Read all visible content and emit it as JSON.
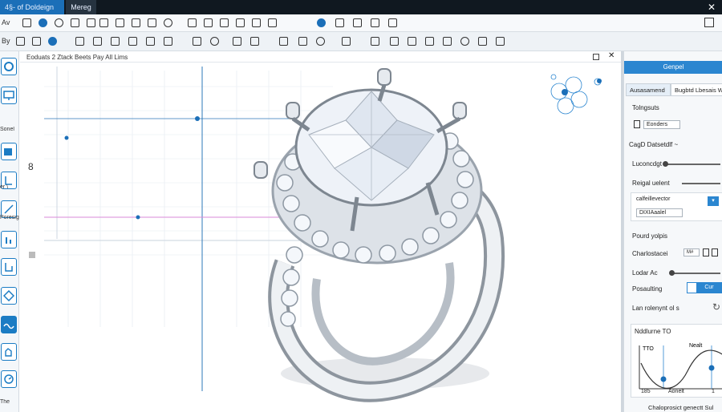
{
  "titlebar": {
    "tabs": [
      "4§- of Doldeign",
      "Mereg"
    ]
  },
  "toolbar1": {
    "label_left": "Av"
  },
  "toolbar2": {
    "label_left": "By"
  },
  "left_rail": {
    "labels": [
      "Sonel",
      "er  \\",
      "Poresign",
      "The"
    ]
  },
  "viewport": {
    "title": "Eoduats 2 Ztack Beets Pay All Lims",
    "dim_label": "8",
    "colors": {
      "grid": "#d9e1ea",
      "guide": "#1b6fb8",
      "pink_line": "#d98ad8"
    }
  },
  "right_panel": {
    "header": "Genpel",
    "tabs": [
      "Ausasamend",
      "Bugbtd Lbesais Wa"
    ],
    "toolgroup_label": "Tolngsuts",
    "toolgroup_button": "Eonders",
    "section_title": "CagD Datsetdlf ~",
    "rows": [
      "Luconcdgt",
      "Reigal uelent"
    ],
    "select_label": "calfeillevector",
    "select_value": "DIXIAaalel",
    "properties_title": "Pourd yolpis",
    "char_label": "Charlostacei",
    "char_box": "M#",
    "lodar_label": "Lodar Ac",
    "pos_label": "Posaulting",
    "pos_toggle": "Cur",
    "lan_label": "Lan rolenynt ol s",
    "graph_title": "Nddlurne TO",
    "graph_label_a": "TTO",
    "graph_label_b": "Nealt",
    "graph_x1": "185",
    "graph_x2": "Aonelt",
    "graph_x3": "1",
    "footer": "Chaloprosict genectt Sul"
  }
}
